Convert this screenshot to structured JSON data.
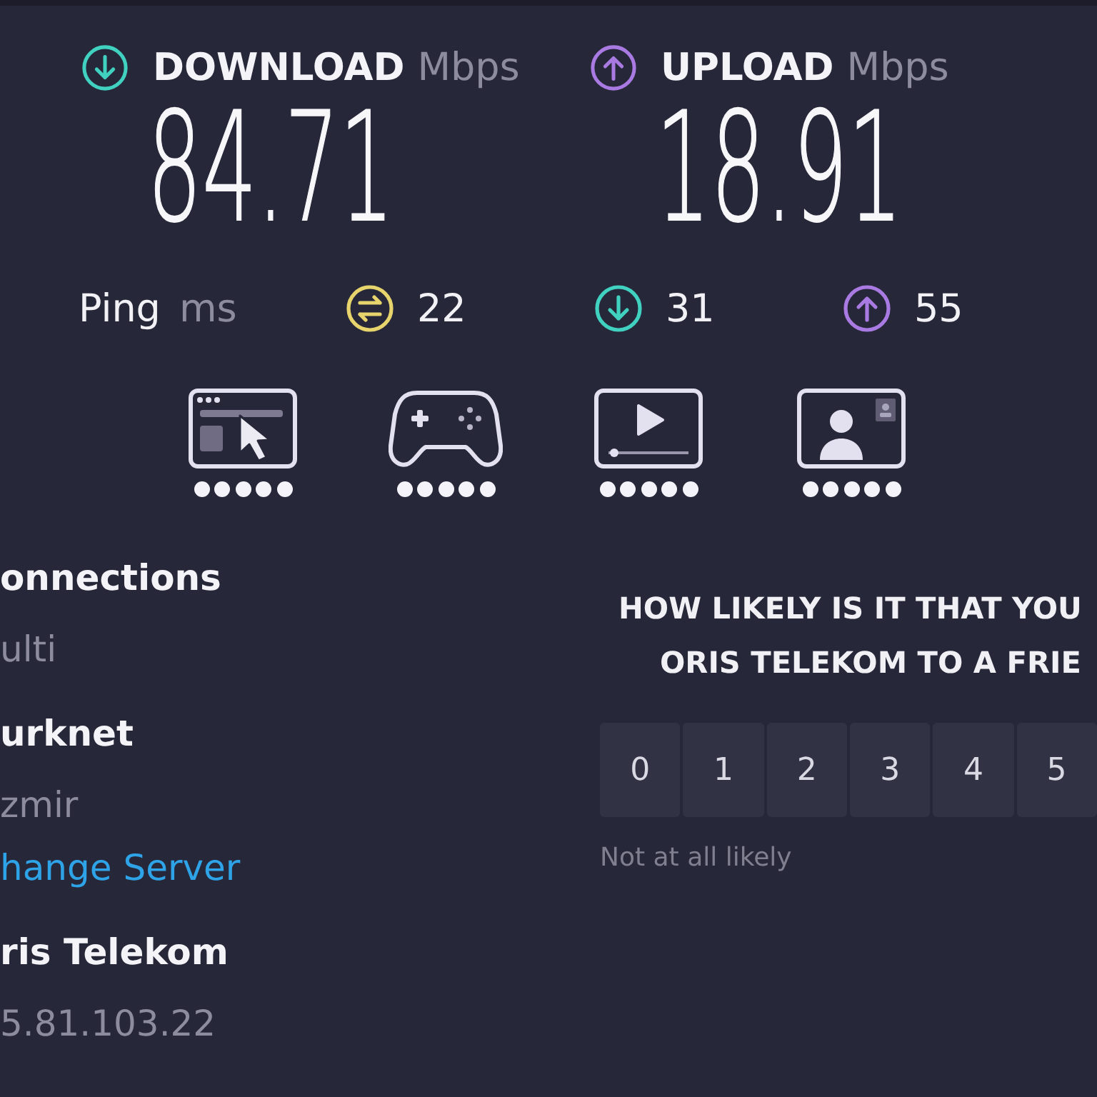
{
  "speeds": [
    {
      "kind": "download",
      "label": "DOWNLOAD",
      "unit": "Mbps",
      "value": "84.71"
    },
    {
      "kind": "upload",
      "label": "UPLOAD",
      "unit": "Mbps",
      "value": "18.91"
    }
  ],
  "ping": {
    "label": "Ping",
    "unit": "ms",
    "stats": [
      {
        "kind": "idle",
        "value": "22"
      },
      {
        "kind": "download",
        "value": "31"
      },
      {
        "kind": "upload",
        "value": "55"
      }
    ]
  },
  "use_cases": [
    {
      "kind": "browsing",
      "stars": 5
    },
    {
      "kind": "gaming",
      "stars": 5
    },
    {
      "kind": "streaming",
      "stars": 5
    },
    {
      "kind": "video_call",
      "stars": 5
    }
  ],
  "details": [
    {
      "title": "onnections",
      "value": "ulti"
    },
    {
      "title": "urknet",
      "value": "zmir",
      "link": "hange Server"
    },
    {
      "title": "ris Telekom",
      "value": "5.81.103.22"
    }
  ],
  "survey": {
    "question_lines": [
      "HOW LIKELY IS IT THAT YOU",
      "ORIS TELEKOM TO A FRIE"
    ],
    "scores": [
      {
        "label": "0",
        "selected": false
      },
      {
        "label": "1",
        "selected": false
      },
      {
        "label": "2",
        "selected": false
      },
      {
        "label": "3",
        "selected": false
      },
      {
        "label": "4",
        "selected": false
      },
      {
        "label": "5",
        "selected": false
      }
    ],
    "min_label": "Not at all likely"
  }
}
